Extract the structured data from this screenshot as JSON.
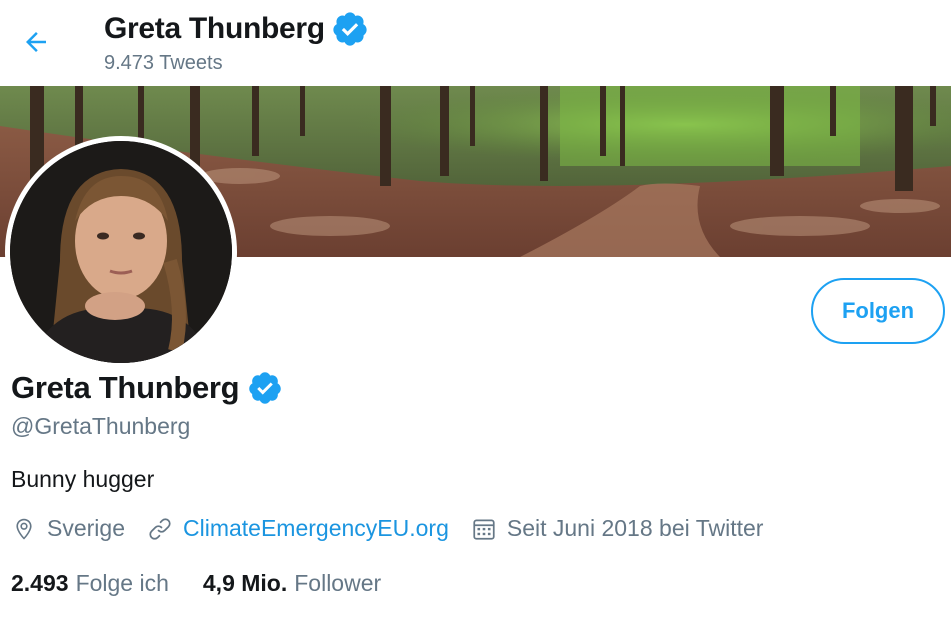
{
  "header": {
    "name": "Greta Thunberg",
    "tweet_count": "9.473 Tweets"
  },
  "profile": {
    "name": "Greta Thunberg",
    "handle": "@GretaThunberg",
    "bio": "Bunny hugger",
    "location": "Sverige",
    "website": "ClimateEmergencyEU.org",
    "joined": "Seit Juni 2018 bei Twitter"
  },
  "follow_button": {
    "label": "Folgen"
  },
  "stats": {
    "following_count": "2.493",
    "following_label": "Folge ich",
    "followers_count": "4,9 Mio.",
    "followers_label": "Follower"
  },
  "colors": {
    "accent": "#1da1f2",
    "link": "#1b95e0",
    "secondary_text": "#657786",
    "primary_text": "#14171a"
  },
  "icons": [
    "back-arrow-icon",
    "verified-badge-icon",
    "location-icon",
    "link-icon",
    "calendar-icon"
  ]
}
